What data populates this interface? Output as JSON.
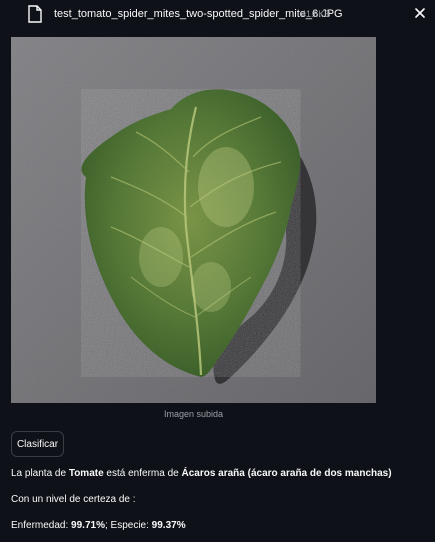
{
  "file": {
    "name": "test_tomato_spider_mites_two-spotted_spider_mite_6.JPG",
    "size": "41.6KB"
  },
  "image": {
    "caption": "Imagen subida"
  },
  "actions": {
    "classify_label": "Clasificar"
  },
  "result": {
    "prefix": "La planta de ",
    "plant": "Tomate",
    "middle": " está enferma de ",
    "disease": "Ácaros araña (ácaro araña de dos manchas)",
    "certainty_label": "Con un nivel de certeza de :",
    "disease_label": "Enfermedad: ",
    "disease_pct": "99.71%",
    "separator": "; ",
    "species_label": "Especie: ",
    "species_pct": "99.37%"
  },
  "colors": {
    "background": "#0e1117",
    "text": "#fafafa",
    "muted": "#9aa0a6"
  }
}
